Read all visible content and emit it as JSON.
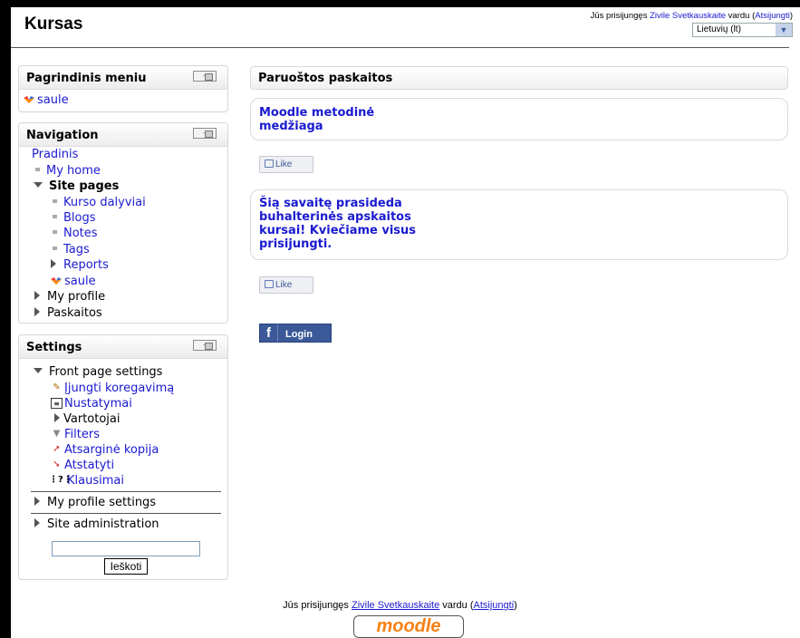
{
  "header": {
    "site_title": "Kursas",
    "login_prefix": "Jūs prisijungęs ",
    "user_name": "Zivile Svetkauskaite",
    "login_middle": " vardu (",
    "logout_label": "Atsijungti",
    "login_suffix": ")",
    "language": "Lietuvių (lt)"
  },
  "main_menu_block": {
    "title": "Pagrindinis meniu",
    "items": [
      {
        "label": "saule",
        "icon": "hotpot-icon"
      }
    ]
  },
  "navigation_block": {
    "title": "Navigation",
    "root": "Pradinis",
    "my_home": "My home",
    "site_pages": "Site pages",
    "site_items": [
      "Kurso dalyviai",
      "Blogs",
      "Notes",
      "Tags"
    ],
    "reports": "Reports",
    "saule": "saule",
    "my_profile": "My profile",
    "paskaitos": "Paskaitos"
  },
  "settings_block": {
    "title": "Settings",
    "front_page": "Front page settings",
    "items": [
      {
        "label": "Įjungti koregavimą",
        "icon": "edit-icon"
      },
      {
        "label": "Nustatymai",
        "icon": "settings-icon"
      },
      {
        "label": "Vartotojai",
        "icon": "expand-icon"
      },
      {
        "label": "Filters",
        "icon": "filter-icon"
      },
      {
        "label": "Atsarginė kopija",
        "icon": "backup-icon"
      },
      {
        "label": "Atstatyti",
        "icon": "restore-icon"
      },
      {
        "label": "Klausimai",
        "icon": "questions-icon"
      }
    ],
    "my_profile_settings": "My profile settings",
    "site_administration": "Site administration",
    "search_value": "",
    "search_button": "Ieškoti"
  },
  "main": {
    "section_title": "Paruoštos paskaitos",
    "post1": [
      "Moodle metodinė",
      "medžiaga"
    ],
    "post2": [
      "Šią savaitę prasideda",
      "buhalterinės apskaitos",
      "kursai! Kviečiame visus",
      "prisijungti."
    ],
    "like_label": "Like",
    "fb_login_label": "Login"
  },
  "footer": {
    "prefix": "Jūs prisijungęs ",
    "user_name": "Zivile Svetkauskaite",
    "middle": " vardu (",
    "logout": "Atsijungti",
    "suffix": ")",
    "logo": "moodle"
  },
  "colors": {
    "link": "#1a1ad0",
    "facebook": "#3b5998",
    "moodle_orange": "#f98012"
  }
}
